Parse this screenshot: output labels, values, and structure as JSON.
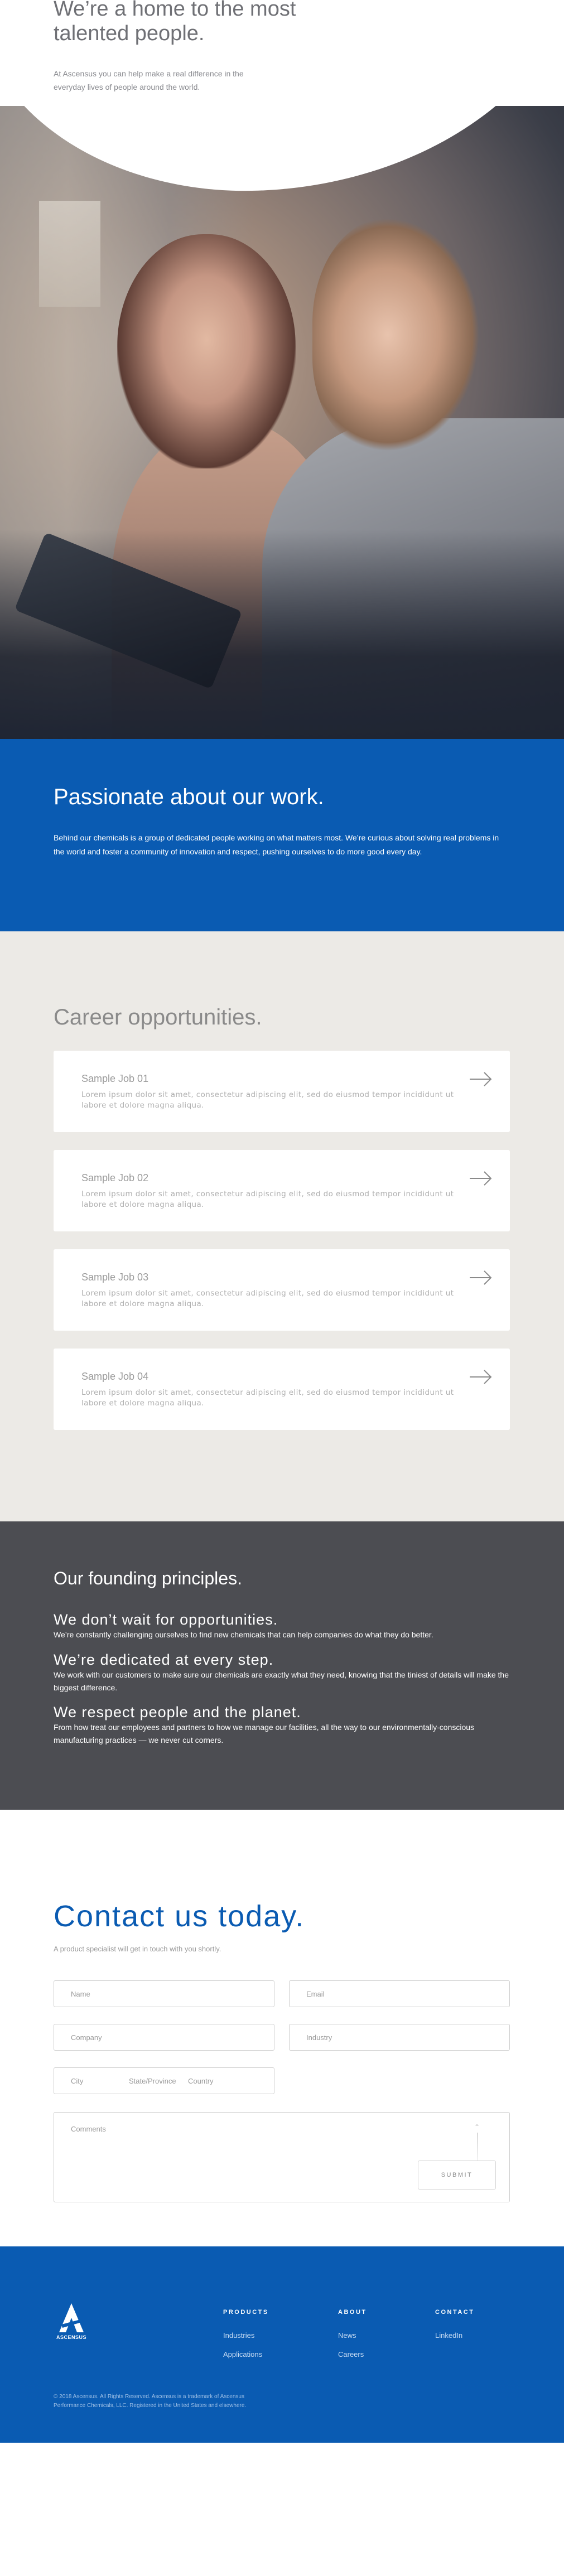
{
  "intro": {
    "title": "We’re a home to the most\ntalented people.",
    "text": "At Ascensus you can help make a real difference in the everyday lives of people around the world."
  },
  "passion": {
    "title": "Passionate about our work.",
    "text": "Behind our chemicals is a group of dedicated people working on what matters most. We’re curious about solving real problems in the world and foster a community of innovation and respect, pushing ourselves to do more good every day."
  },
  "careers": {
    "title": "Career opportunities.",
    "jobs": [
      {
        "title": "Sample Job 01",
        "description": "Lorem ipsum dolor sit amet, consectetur adipiscing elit, sed do eiusmod tempor incididunt ut labore et dolore magna aliqua."
      },
      {
        "title": "Sample Job 02",
        "description": "Lorem ipsum dolor sit amet, consectetur adipiscing elit, sed do eiusmod tempor incididunt ut labore et dolore magna aliqua."
      },
      {
        "title": "Sample Job 03",
        "description": "Lorem ipsum dolor sit amet, consectetur adipiscing elit, sed do eiusmod tempor incididunt ut labore et dolore magna aliqua."
      },
      {
        "title": "Sample Job 04",
        "description": "Lorem ipsum dolor sit amet, consectetur adipiscing elit, sed do eiusmod tempor incididunt ut labore et dolore magna aliqua."
      }
    ],
    "arrow_icon": "arrow-right-icon"
  },
  "principles": {
    "title": "Our founding principles.",
    "items": [
      {
        "heading": "We don’t wait for opportunities.",
        "text": "We’re constantly challenging ourselves to find new chemicals that can help companies do what they do better."
      },
      {
        "heading": "We’re dedicated at every step.",
        "text": "We work with our customers to make sure our chemicals are exactly what they need, knowing that the tiniest of details will make the biggest difference."
      },
      {
        "heading": "We respect people and the planet.",
        "text": "From how treat our employees and partners to how we manage our facilities, all the way to our environmentally-conscious manufacturing practices — we never cut corners."
      }
    ]
  },
  "contact": {
    "title": "Contact us today.",
    "subtitle": "A product specialist will get in touch with you shortly.",
    "fields": {
      "name": "Name",
      "email": "Email",
      "company": "Company",
      "industry": "Industry",
      "city": "City",
      "state": "State/Province",
      "country": "Country",
      "comments": "Comments"
    },
    "submit": "SUBMIT",
    "scroll_icon": "chevron-up-icon"
  },
  "footer": {
    "logo_text": "ASCENSUS",
    "columns": [
      {
        "heading": "PRODUCTS",
        "links": [
          "Industries",
          "Applications"
        ]
      },
      {
        "heading": "ABOUT",
        "links": [
          "News",
          "Careers"
        ]
      },
      {
        "heading": "CONTACT",
        "links": [
          "LinkedIn"
        ]
      }
    ],
    "legal": "© 2018 Ascensus. All Rights Reserved. Ascensus is a trademark of Ascensus Performance Chemicals, LLC. Registered in the United States and elsewhere."
  },
  "colors": {
    "brand_blue": "#0a5bb2",
    "principles_bg": "#4c4d52",
    "careers_bg": "#eceae6"
  }
}
